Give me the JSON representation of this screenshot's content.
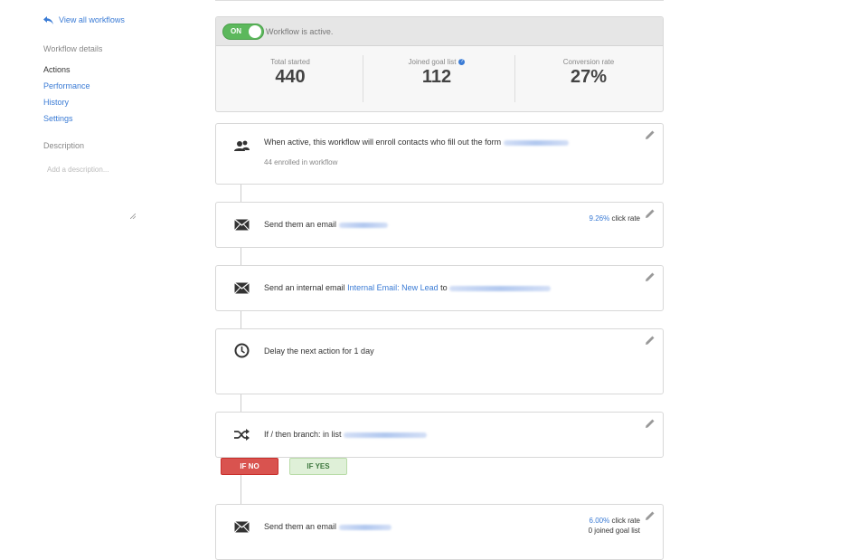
{
  "sidebar": {
    "back_label": "View all workflows",
    "section_title": "Workflow details",
    "items": [
      {
        "label": "Actions"
      },
      {
        "label": "Performance"
      },
      {
        "label": "History"
      },
      {
        "label": "Settings"
      }
    ],
    "description_title": "Description",
    "description_placeholder": "Add a description..."
  },
  "status": {
    "toggle_label": "ON",
    "active_text": "Workflow is active.",
    "stats": [
      {
        "label": "Total started",
        "value": "440"
      },
      {
        "label": "Joined goal list",
        "value": "112"
      },
      {
        "label": "Conversion rate",
        "value": "27%"
      }
    ]
  },
  "steps": {
    "enroll": {
      "text": "When active, this workflow will enroll contacts who fill out the form",
      "sub": "44 enrolled in workflow"
    },
    "email1": {
      "text": "Send them an email",
      "rate_pct": "9.26%",
      "rate_label": "click rate"
    },
    "internal": {
      "text_pre": "Send an internal email",
      "link": "Internal Email: New Lead",
      "text_to": "to"
    },
    "delay": {
      "text": "Delay the next action for 1 day"
    },
    "branch": {
      "text": "If / then branch: in list",
      "no_label": "IF NO",
      "yes_label": "IF YES"
    },
    "email2": {
      "text": "Send them an email",
      "rate_pct": "6.00%",
      "rate_label": "click rate",
      "goal_text": "0 joined goal list"
    }
  },
  "colors": {
    "accent": "#3a7bd5",
    "toggle_on": "#5cb85c",
    "branch_no": "#d9534f",
    "branch_yes": "#dff0d8"
  }
}
